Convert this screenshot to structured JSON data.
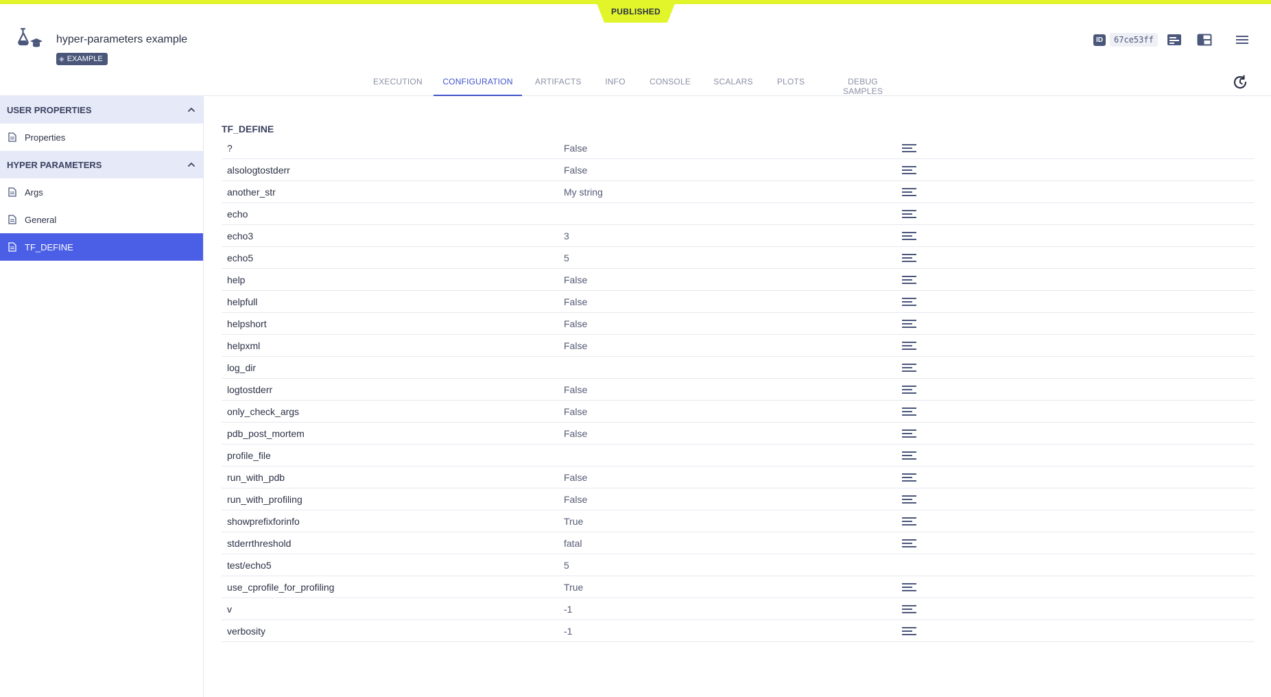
{
  "status_flag": "PUBLISHED",
  "header": {
    "title": "hyper-parameters example",
    "tag": "EXAMPLE",
    "id_badge": "ID",
    "id_value": "67ce53ff"
  },
  "tabs": [
    {
      "label": "EXECUTION",
      "active": false
    },
    {
      "label": "CONFIGURATION",
      "active": true
    },
    {
      "label": "ARTIFACTS",
      "active": false
    },
    {
      "label": "INFO",
      "active": false
    },
    {
      "label": "CONSOLE",
      "active": false
    },
    {
      "label": "SCALARS",
      "active": false
    },
    {
      "label": "PLOTS",
      "active": false
    },
    {
      "label": "DEBUG SAMPLES",
      "active": false
    }
  ],
  "sidebar": {
    "sections": [
      {
        "title": "USER PROPERTIES",
        "items": [
          "Properties"
        ]
      },
      {
        "title": "HYPER PARAMETERS",
        "items": [
          "Args",
          "General",
          "TF_DEFINE"
        ]
      }
    ],
    "active_item": "TF_DEFINE"
  },
  "content": {
    "section_title": "TF_DEFINE",
    "rows": [
      {
        "key": "?",
        "value": "False",
        "has_desc": true
      },
      {
        "key": "alsologtostderr",
        "value": "False",
        "has_desc": true
      },
      {
        "key": "another_str",
        "value": "My string",
        "has_desc": true
      },
      {
        "key": "echo",
        "value": "",
        "has_desc": true
      },
      {
        "key": "echo3",
        "value": "3",
        "has_desc": true
      },
      {
        "key": "echo5",
        "value": "5",
        "has_desc": true
      },
      {
        "key": "help",
        "value": "False",
        "has_desc": true
      },
      {
        "key": "helpfull",
        "value": "False",
        "has_desc": true
      },
      {
        "key": "helpshort",
        "value": "False",
        "has_desc": true
      },
      {
        "key": "helpxml",
        "value": "False",
        "has_desc": true
      },
      {
        "key": "log_dir",
        "value": "",
        "has_desc": true
      },
      {
        "key": "logtostderr",
        "value": "False",
        "has_desc": true
      },
      {
        "key": "only_check_args",
        "value": "False",
        "has_desc": true
      },
      {
        "key": "pdb_post_mortem",
        "value": "False",
        "has_desc": true
      },
      {
        "key": "profile_file",
        "value": "",
        "has_desc": true
      },
      {
        "key": "run_with_pdb",
        "value": "False",
        "has_desc": true
      },
      {
        "key": "run_with_profiling",
        "value": "False",
        "has_desc": true
      },
      {
        "key": "showprefixforinfo",
        "value": "True",
        "has_desc": true
      },
      {
        "key": "stderrthreshold",
        "value": "fatal",
        "has_desc": true
      },
      {
        "key": "test/echo5",
        "value": "5",
        "has_desc": false
      },
      {
        "key": "use_cprofile_for_profiling",
        "value": "True",
        "has_desc": true
      },
      {
        "key": "v",
        "value": "-1",
        "has_desc": true
      },
      {
        "key": "verbosity",
        "value": "-1",
        "has_desc": true
      }
    ]
  },
  "colors": {
    "accent_lime": "#e1f52a",
    "active_blue": "#4b5fe6",
    "tab_active": "#3f52c9",
    "section_bg": "#e6e9f7",
    "text_dark": "#2c3246"
  },
  "icons": {
    "app": "hyperparameter-flask-icon",
    "tag": "example-tag-icon",
    "details": "details-panel-icon",
    "layout": "layout-toggle-icon",
    "menu": "hamburger-menu-icon",
    "refresh": "refresh-icon",
    "section_toggle": "chevron-up-icon",
    "file": "document-icon",
    "row_desc": "description-lines-icon"
  }
}
